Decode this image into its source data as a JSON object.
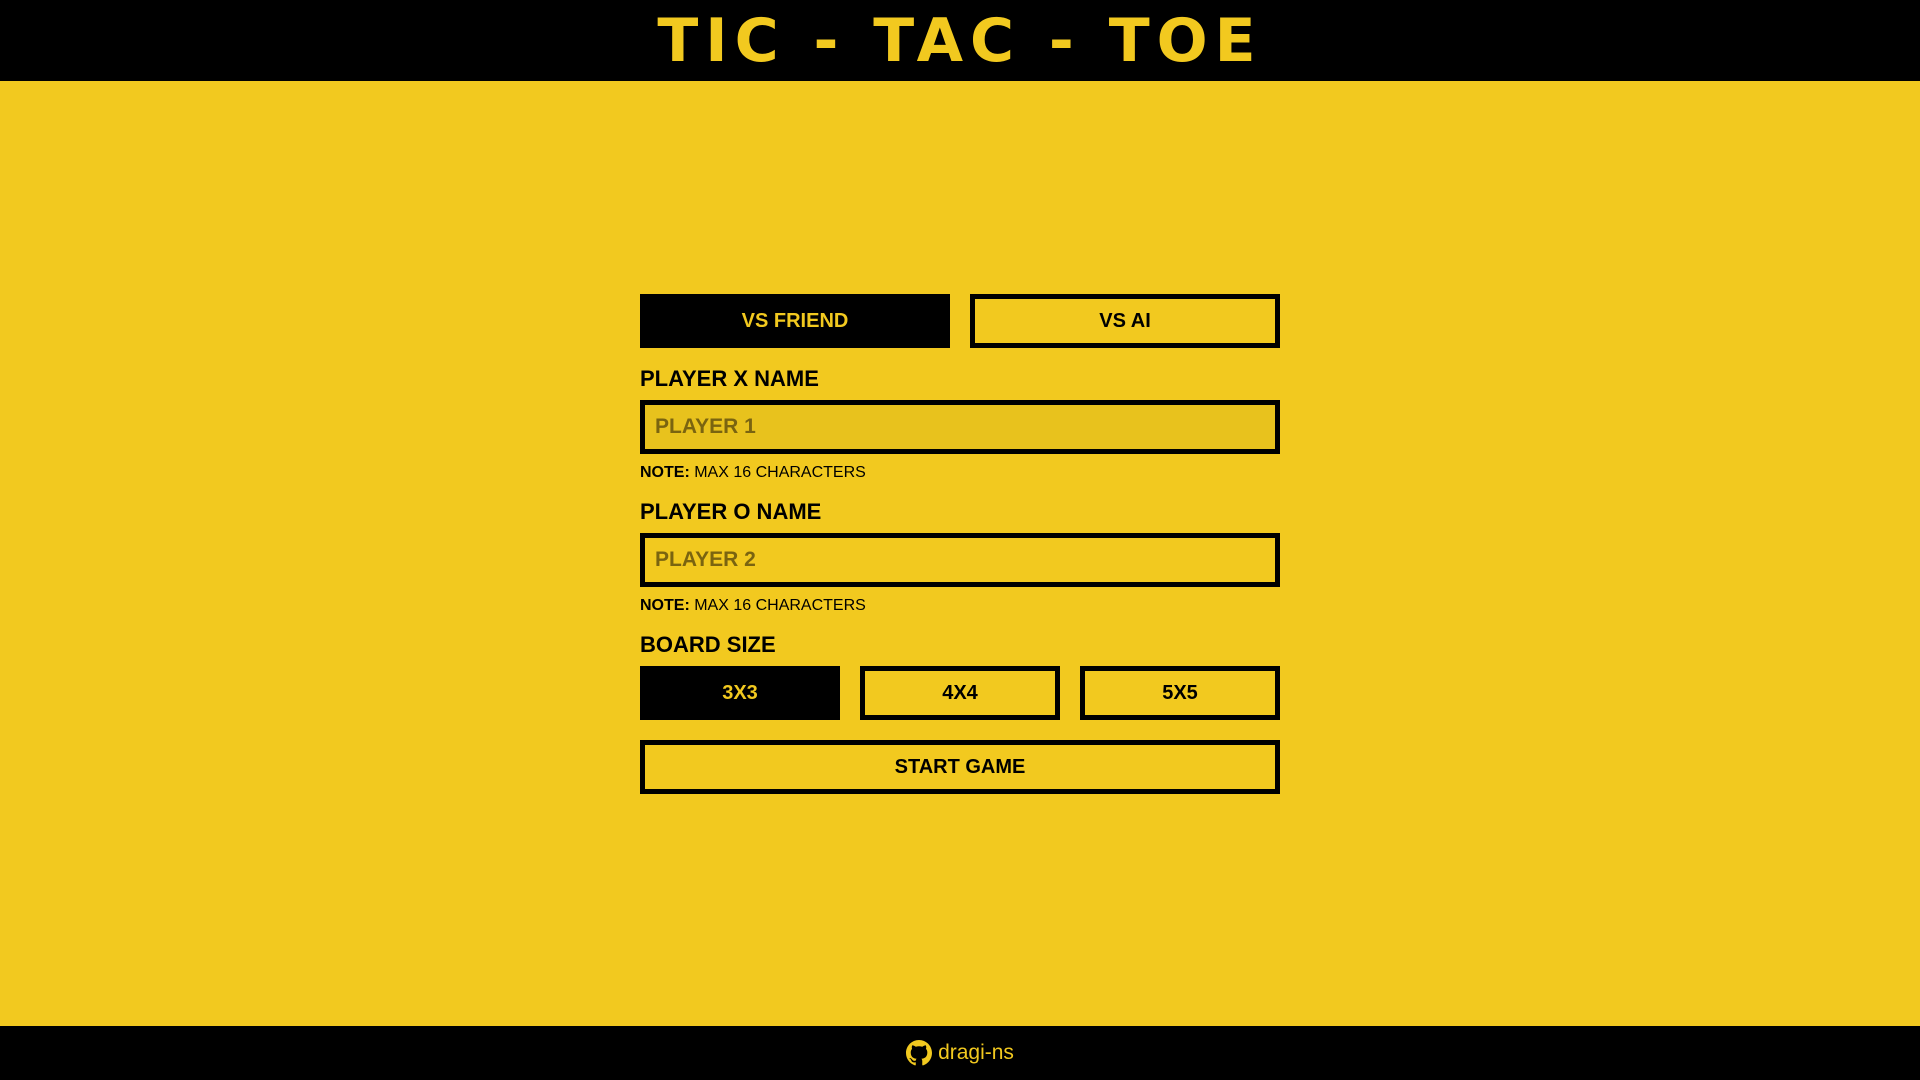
{
  "header": {
    "title": "TIC - TAC - TOE"
  },
  "mode": {
    "vs_friend": "VS FRIEND",
    "vs_ai": "VS AI",
    "selected": "vs_friend"
  },
  "player_x": {
    "label": "PLAYER X NAME",
    "placeholder": "PLAYER 1",
    "value": "",
    "note_prefix": "NOTE:",
    "note_text": " MAX 16 CHARACTERS"
  },
  "player_o": {
    "label": "PLAYER O NAME",
    "placeholder": "PLAYER 2",
    "value": "",
    "note_prefix": "NOTE:",
    "note_text": " MAX 16 CHARACTERS"
  },
  "board_size": {
    "label": "BOARD SIZE",
    "options": [
      "3X3",
      "4X4",
      "5X5"
    ],
    "selected": "3X3"
  },
  "start_button": "START GAME",
  "footer": {
    "link_text": "dragi-ns",
    "icon": "github-icon"
  },
  "colors": {
    "background": "#f2c91f",
    "accent": "#000000",
    "text_on_dark": "#f2c91f"
  }
}
